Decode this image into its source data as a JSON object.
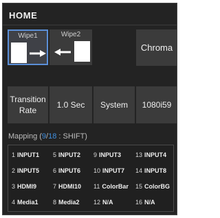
{
  "header": {
    "title": "HOME"
  },
  "transitions": {
    "wipe1": {
      "label": "Wipe1",
      "selected": true,
      "direction": "right"
    },
    "wipe2": {
      "label": "Wipe2",
      "selected": false,
      "direction": "left"
    },
    "chroma": {
      "label": "Chroma"
    }
  },
  "controls": {
    "transition_rate_label": "Transition\nRate",
    "rate_value": "1.0 Sec",
    "system_label": "System",
    "format_value": "1080i59"
  },
  "mapping": {
    "prefix": "Mapping (",
    "current": "9",
    "separator": "/",
    "total": "18",
    "suffix": " : SHIFT)",
    "cells": [
      {
        "num": "1",
        "src": "INPUT1"
      },
      {
        "num": "5",
        "src": "INPUT2"
      },
      {
        "num": "9",
        "src": "INPUT3"
      },
      {
        "num": "13",
        "src": "INPUT4"
      },
      {
        "num": "2",
        "src": "INPUT5"
      },
      {
        "num": "6",
        "src": "INPUT6"
      },
      {
        "num": "10",
        "src": "INPUT7"
      },
      {
        "num": "14",
        "src": "INPUT8"
      },
      {
        "num": "3",
        "src": "HDMI9"
      },
      {
        "num": "7",
        "src": "HDMI10"
      },
      {
        "num": "11",
        "src": "ColorBar"
      },
      {
        "num": "15",
        "src": "ColorBG"
      },
      {
        "num": "4",
        "src": "Media1"
      },
      {
        "num": "8",
        "src": "Media2"
      },
      {
        "num": "12",
        "src": "N/A"
      },
      {
        "num": "16",
        "src": "N/A"
      }
    ]
  },
  "colors": {
    "panel_bg": "#232323",
    "tile_bg": "#3b3b3b",
    "selection_border": "#5b8fd8",
    "mapping_accent": "#3f8fe0"
  }
}
